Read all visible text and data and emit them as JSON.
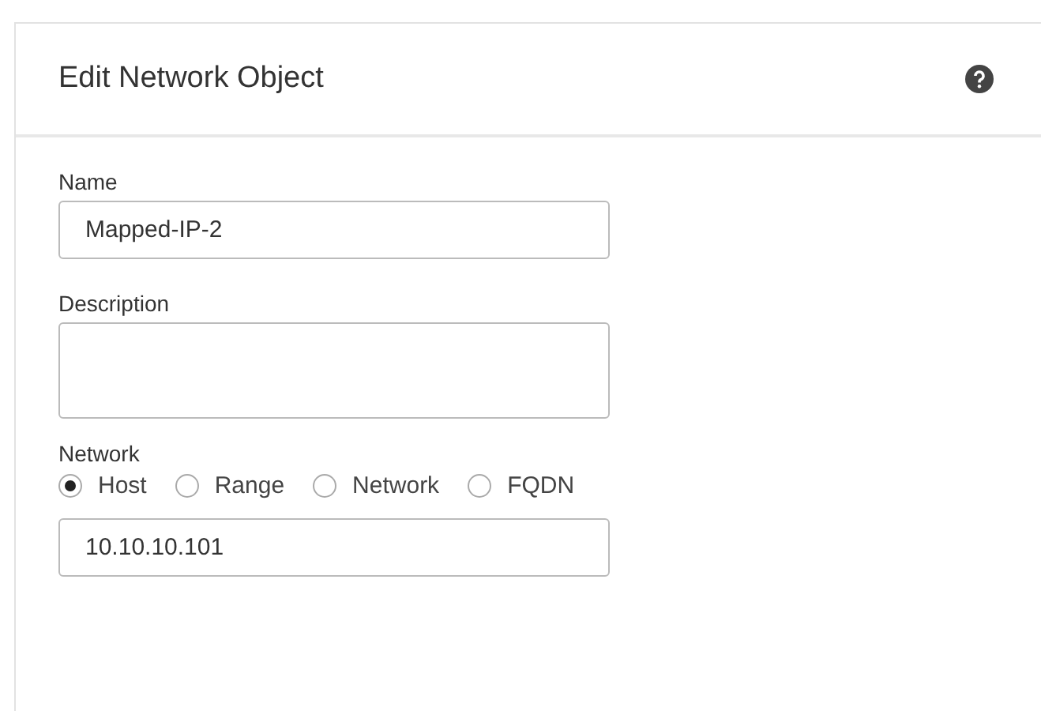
{
  "dialog": {
    "title": "Edit Network Object"
  },
  "fields": [
    {
      "kind": "input",
      "label": "Name",
      "value": "Mapped-IP-2"
    },
    {
      "kind": "textarea",
      "label": "Description"
    }
  ],
  "network": {
    "label": "Network",
    "options": [
      {
        "label": "Host",
        "selected": true
      },
      {
        "label": "Range",
        "selected": false
      },
      {
        "label": "Network",
        "selected": false
      },
      {
        "label": "FQDN",
        "selected": false
      }
    ],
    "value": "10.10.10.101"
  }
}
